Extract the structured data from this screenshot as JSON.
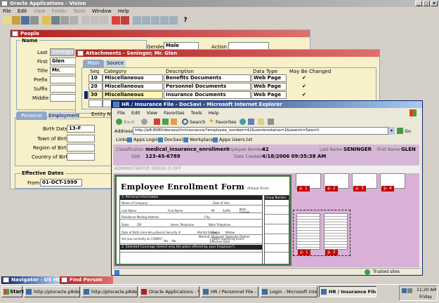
{
  "oracle": {
    "title": "Oracle Applications - Vision",
    "menu": [
      "File",
      "Edit",
      "View",
      "Folder",
      "Tools",
      "Window",
      "Help"
    ]
  },
  "people": {
    "title": "People",
    "name_section": "Name",
    "last_label": "Last",
    "last_value": "Seninger",
    "first_label": "First",
    "first_value": "Glen",
    "title_label": "Title",
    "title_value": "Mr.",
    "prefix_label": "Prefix",
    "suffix_label": "Suffix",
    "middle_label": "Middle",
    "gender_label": "Gender",
    "gender_value": "Male",
    "action_label": "Action",
    "tabs": [
      "Personal",
      "Employment"
    ],
    "birth_date_label": "Birth Date",
    "birth_date_value": "13-F",
    "town_label": "Town of Birth",
    "region_label": "Region of Birth",
    "country_label": "Country of Birth",
    "effective_dates_label": "Effective Dates",
    "from_label": "From",
    "from_value": "01-OCT-1999"
  },
  "attachments": {
    "title": "Attachments - Seninger, Mr. Glen",
    "tabs": [
      "Main",
      "Source"
    ],
    "headers": {
      "seq": "Seq",
      "category": "Category",
      "description": "Description",
      "data_type": "Data Type",
      "may_be_changed": "May Be Changed"
    },
    "rows": [
      {
        "seq": "10",
        "category": "Miscellaneous",
        "description": "Benefits Documents",
        "data_type": "Web Page",
        "checked": "✔"
      },
      {
        "seq": "20",
        "category": "Miscellaneous",
        "description": "Personnel Documents",
        "data_type": "Web Page",
        "checked": "✔"
      },
      {
        "seq": "30",
        "category": "Miscellaneous",
        "description": "Insurance Documents",
        "data_type": "Web Page",
        "checked": "✔"
      }
    ],
    "entity_label": "Entity Na"
  },
  "ie": {
    "title": "HR / Insurance File - DocSavi - Microsoft Internet Explorer",
    "menu": [
      "File",
      "Edit",
      "View",
      "Favorites",
      "Tools",
      "Help"
    ],
    "back_label": "Back",
    "search_label": "Search",
    "favorites_label": "Favorites",
    "address_label": "Address",
    "address_value": "http://p8:8080/docsavi/hr/insurance/?employee_number=42&versionstatus=1&search=Search",
    "go_label": "Go",
    "links_label": "Links",
    "links": [
      "Apps Login",
      "DocSavi",
      "Workplace",
      "Apps Users.txt"
    ],
    "classification_label": "Classification",
    "classification_value": "medical_insurance_enrollment",
    "ssn_label": "SSN",
    "ssn_value": "123-45-6789",
    "employee_number_label": "Employee Number",
    "employee_number_value": "42",
    "date_created_label": "Date Created",
    "date_created_value": "4/18/2006 09:35:38 AM",
    "last_name_label": "Last Name",
    "last_name_value": "SENINGER",
    "first_name_label": "First Name",
    "first_name_value": "GLEN",
    "debug_text": "ADMINISTRATIVE DEBUG IS OFF",
    "doc_title": "Employee Enrollment Form",
    "doc_title_note": "(Please Print)",
    "section1": "1. Personal Information",
    "section2": "2. Selected Coverage",
    "section2_note": "(Select only the plans offered by your Employer!)",
    "form_fields": [
      "Name of Company",
      "Date of Hire",
      "Last Name",
      "First Name",
      "MI",
      "Suffix",
      "Male",
      "Female",
      "Residence Mailing Address",
      "City",
      "State",
      "ZIP",
      "Home Telephone",
      "Work Telephone",
      "Date of Birth (mm-dd-yy)",
      "Social Security #",
      "Marital Status",
      "Single",
      "Widow",
      "Married",
      "Divorced",
      "Domestic Partner",
      "Are you currently on COBRA?",
      "Yes",
      "No",
      "COBRA Qualifying Event",
      "Effective Date"
    ],
    "side_form_title": "Group Number",
    "pages": [
      "p. 1",
      "p. 2",
      "p. 3",
      "p. 4",
      "p. 1",
      "p. 2"
    ],
    "status_text": "Trusted sites"
  },
  "mini_windows": [
    {
      "label": "Navigator - US HR"
    },
    {
      "label": "Find Person"
    }
  ],
  "taskbar": {
    "start": "Start",
    "buttons": [
      "http://ptoracle.p8demo....",
      "http://ptoracle.p8demo....",
      "Oracle Applications - Vision",
      "HR / Personnel File - Doc...",
      "Login - Microsoft Interne...",
      "HR / Insurance File - Doc..."
    ],
    "time": "11:20 AM",
    "day": "Friday"
  },
  "colors": {
    "oracle_bg": "#f7f0c9",
    "oracle_accent": "#8ea6c8",
    "ie_meta_bg": "#d7b7d7",
    "ie_viewer_bg": "#d9b0d6",
    "doc_border": "#4a7a4a",
    "title_blue": "#0a246a"
  }
}
